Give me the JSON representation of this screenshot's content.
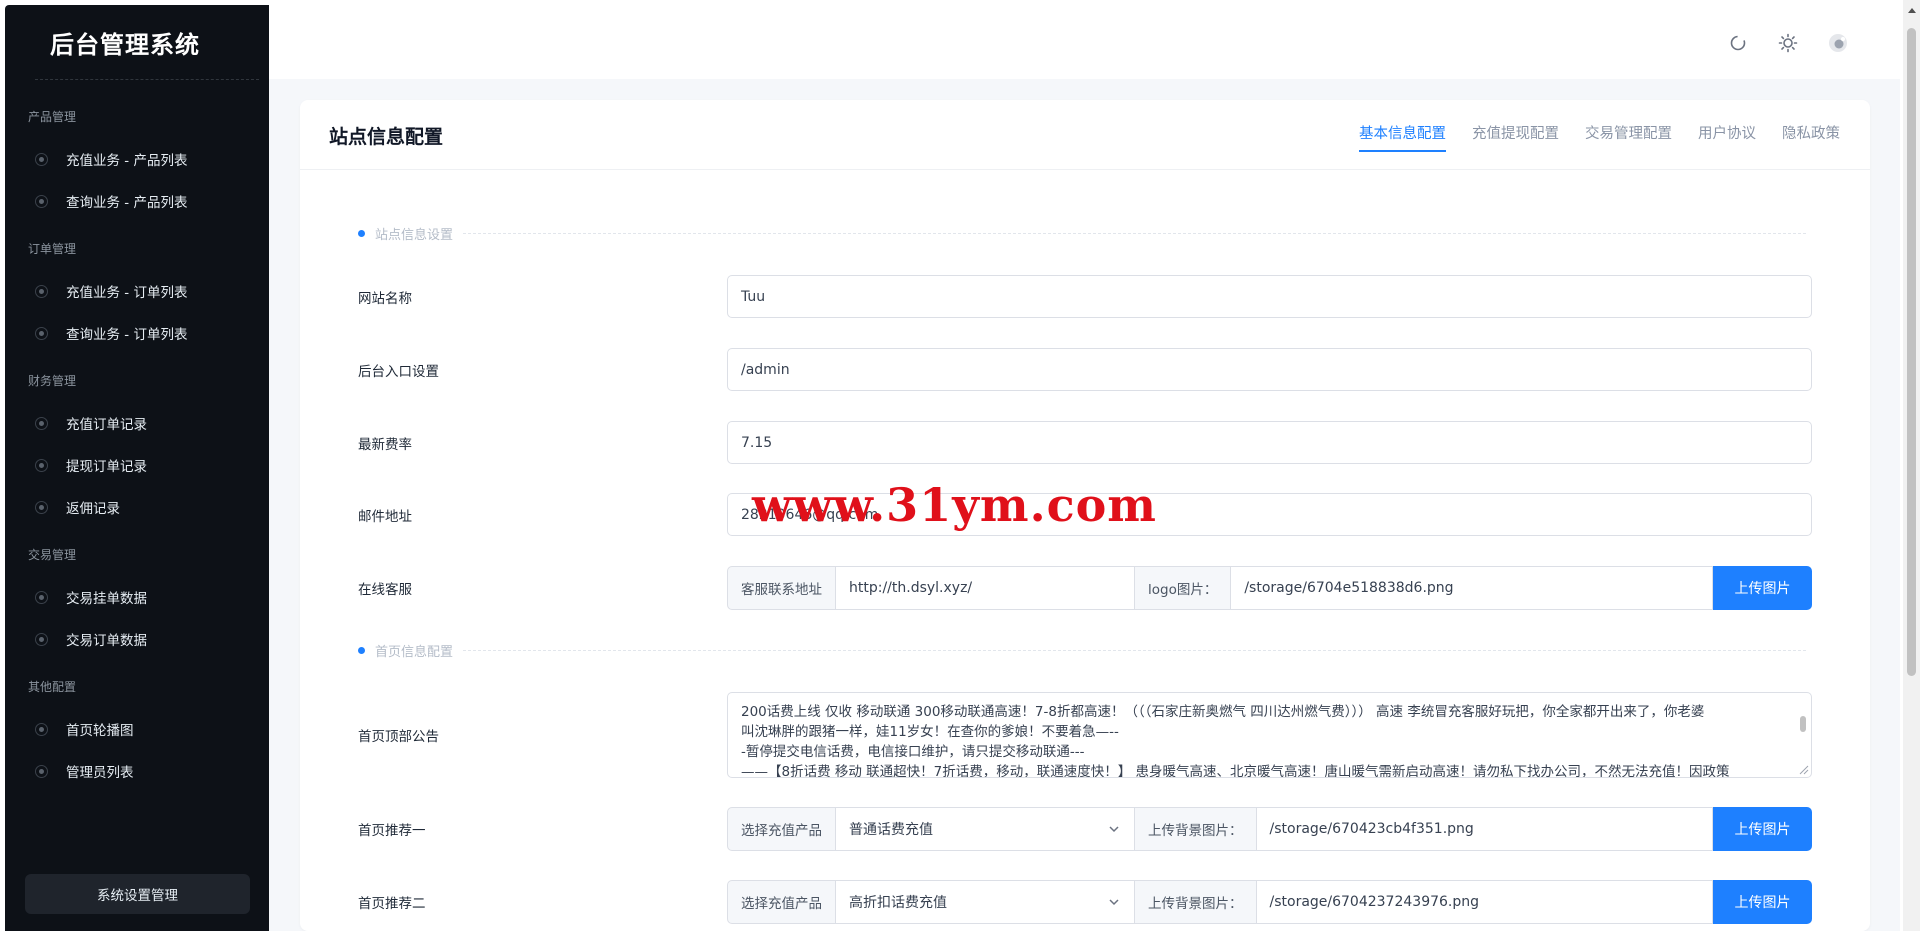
{
  "sidebar": {
    "brand": "后台管理系统",
    "groups": [
      {
        "title": "产品管理",
        "items": [
          "充值业务 - 产品列表",
          "查询业务 - 产品列表"
        ]
      },
      {
        "title": "订单管理",
        "items": [
          "充值业务 - 订单列表",
          "查询业务 - 订单列表"
        ]
      },
      {
        "title": "财务管理",
        "items": [
          "充值订单记录",
          "提现订单记录",
          "返佣记录"
        ]
      },
      {
        "title": "交易管理",
        "items": [
          "交易挂单数据",
          "交易订单数据"
        ]
      },
      {
        "title": "其他配置",
        "items": [
          "首页轮播图",
          "管理员列表"
        ]
      }
    ],
    "system_button": "系统设置管理"
  },
  "topbar": {
    "icons": [
      "refresh-icon",
      "sun-icon",
      "moon-icon"
    ]
  },
  "card": {
    "title": "站点信息配置",
    "tabs": [
      "基本信息配置",
      "充值提现配置",
      "交易管理配置",
      "用户协议",
      "隐私政策"
    ],
    "active_tab": "基本信息配置"
  },
  "section1": {
    "title": "站点信息设置"
  },
  "section2": {
    "title": "首页信息配置"
  },
  "form": {
    "site_name": {
      "label": "网站名称",
      "value": "Tuu"
    },
    "admin_entry": {
      "label": "后台入口设置",
      "value": "/admin"
    },
    "rate": {
      "label": "最新费率",
      "value": "7.15"
    },
    "email": {
      "label": "邮件地址",
      "value": "28210646@qq.com"
    },
    "service": {
      "label": "在线客服",
      "addon1": "客服联系地址",
      "url": "http://th.dsyl.xyz/",
      "addon2": "logo图片：",
      "logo": "/storage/6704e518838d6.png",
      "button": "上传图片"
    },
    "notice": {
      "label": "首页顶部公告",
      "lines": [
        "200话费上线 仅收 移动联通 300移动联通高速！7-8折都高速！（（（石家庄新奥燃气 四川达州燃气费））） 高速 李统冒充客服好玩把，你全家都开出来了，你老婆",
        "叫沈琳胖的跟猪一样，娃11岁女！在查你的爹娘！不要着急—--",
        "-暂停提交电信话费，电信接口维护，请只提交移动联通---",
        "——【8折话费 移动 联通超快！7折话费，移动，联通速度快！】 患身暖气高速、北京暖气高速！唐山暖气需新启动高速！请勿私下找办公司，不然无法充值！因政策"
      ]
    },
    "rec1": {
      "label": "首页推荐一",
      "addon1": "选择充值产品",
      "product": "普通话费充值",
      "addon2": "上传背景图片：",
      "image": "/storage/670423cb4f351.png",
      "button": "上传图片"
    },
    "rec2": {
      "label": "首页推荐二",
      "addon1": "选择充值产品",
      "product": "高折扣话费充值",
      "addon2": "上传背景图片：",
      "image": "/storage/6704237243976.png",
      "button": "上传图片"
    }
  },
  "watermark": "www.31ym.com",
  "colors": {
    "accent": "#1e80ff",
    "sidebar_bg": "#0d1117",
    "watermark": "#e0101a"
  }
}
